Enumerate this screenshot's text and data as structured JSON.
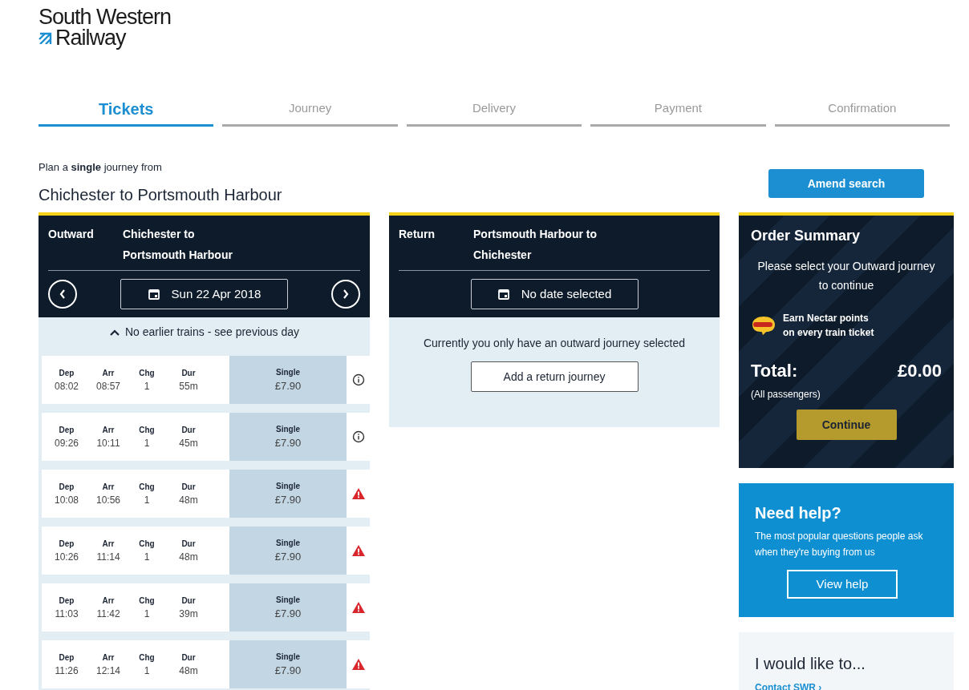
{
  "logo": {
    "line_1": "South Western",
    "line_2": "Railway"
  },
  "steps": [
    {
      "label": "Tickets",
      "selected": true
    },
    {
      "label": "Journey",
      "selected": false
    },
    {
      "label": "Delivery",
      "selected": false
    },
    {
      "label": "Payment",
      "selected": false
    },
    {
      "label": "Confirmation",
      "selected": false
    }
  ],
  "intro": "Plan a **single** journey from",
  "route_title": "Chichester to Portsmouth Harbour",
  "amend_button": "Amend search",
  "outward": {
    "label": "Outward",
    "route_line_1": "Chichester to",
    "route_line_2": "Portsmouth Harbour",
    "date": "Sun 22 Apr 2018",
    "earlier_note": "No earlier trains - see previous day",
    "trains": [
      {
        "cells": [
          {
            "label": "Dep",
            "value": "08:02"
          },
          {
            "label": "Arr",
            "value": "08:57"
          },
          {
            "label": "Chg",
            "value": "1"
          },
          {
            "label": "Dur",
            "value": "55m"
          }
        ],
        "fare_label": "Single",
        "price": "£7.90",
        "kind": "info"
      },
      {
        "cells": [
          {
            "label": "Dep",
            "value": "09:26"
          },
          {
            "label": "Arr",
            "value": "10:11"
          },
          {
            "label": "Chg",
            "value": "1"
          },
          {
            "label": "Dur",
            "value": "45m"
          }
        ],
        "fare_label": "Single",
        "price": "£7.90",
        "kind": "info"
      },
      {
        "cells": [
          {
            "label": "Dep",
            "value": "10:08"
          },
          {
            "label": "Arr",
            "value": "10:56"
          },
          {
            "label": "Chg",
            "value": "1"
          },
          {
            "label": "Dur",
            "value": "48m"
          }
        ],
        "fare_label": "Single",
        "price": "£7.90",
        "kind": "warning"
      },
      {
        "cells": [
          {
            "label": "Dep",
            "value": "10:26"
          },
          {
            "label": "Arr",
            "value": "11:14"
          },
          {
            "label": "Chg",
            "value": "1"
          },
          {
            "label": "Dur",
            "value": "48m"
          }
        ],
        "fare_label": "Single",
        "price": "£7.90",
        "kind": "warning"
      },
      {
        "cells": [
          {
            "label": "Dep",
            "value": "11:03"
          },
          {
            "label": "Arr",
            "value": "11:42"
          },
          {
            "label": "Chg",
            "value": "1"
          },
          {
            "label": "Dur",
            "value": "39m"
          }
        ],
        "fare_label": "Single",
        "price": "£7.90",
        "kind": "warning"
      },
      {
        "cells": [
          {
            "label": "Dep",
            "value": "11:26"
          },
          {
            "label": "Arr",
            "value": "12:14"
          },
          {
            "label": "Chg",
            "value": "1"
          },
          {
            "label": "Dur",
            "value": "48m"
          }
        ],
        "fare_label": "Single",
        "price": "£7.90",
        "kind": "warning"
      }
    ]
  },
  "return": {
    "label": "Return",
    "route_line_1": "Portsmouth Harbour to",
    "route_line_2": "Chichester",
    "date": "No date selected",
    "message": "Currently you only have an outward journey selected",
    "add_button": "Add a return journey"
  },
  "order_summary": {
    "title": "Order Summary",
    "message": "Please select your Outward journey to continue",
    "nectar_line_1": "Earn Nectar points",
    "nectar_line_2": "on every train ticket",
    "total_label": "Total:",
    "total_value": "£0.00",
    "total_note": "(All passengers)",
    "continue_button": "Continue"
  },
  "help": {
    "title": "Need help?",
    "text": "The most popular questions people ask when they're buying from us",
    "button": "View help"
  },
  "links_card": {
    "title": "I would like to...",
    "link": "Contact SWR ›"
  }
}
